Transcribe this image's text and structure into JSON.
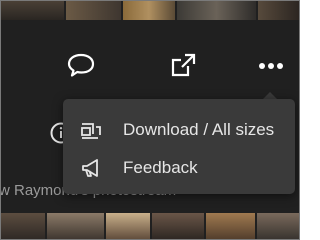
{
  "menu": {
    "items": [
      {
        "label": "Download / All sizes",
        "icon": "download-sizes-icon"
      },
      {
        "label": "Feedback",
        "icon": "megaphone-icon"
      }
    ]
  },
  "toolbar": {
    "icons": [
      "comment-icon",
      "share-icon",
      "more-icon"
    ]
  },
  "background_text": "w Raymond's photostream",
  "colors": {
    "page_background": "#202020",
    "menu_background": "#3a3a3a",
    "menu_text": "#e6e6e6",
    "icon_color": "#ffffff"
  }
}
